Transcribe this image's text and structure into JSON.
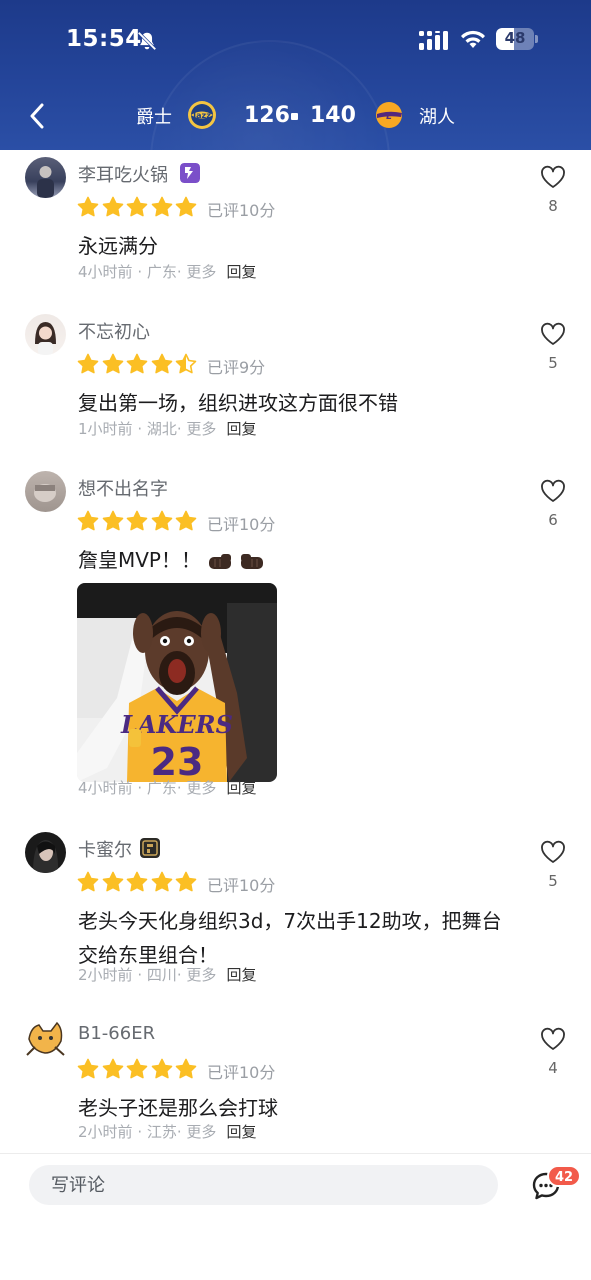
{
  "status_bar": {
    "time": "15:54",
    "battery": "48",
    "battery_fraction": 0.48
  },
  "header": {
    "home_team": "爵士",
    "home_score": "126",
    "away_score": "140",
    "away_team": "湖人",
    "accent": "#24459a"
  },
  "comments": [
    {
      "username": "李耳吃火锅",
      "rating_text": "已评10分",
      "stars": 5,
      "text": "永远满分",
      "time": "4小时前",
      "location": "广东",
      "more": "更多",
      "reply": "回复",
      "likes": "8"
    },
    {
      "username": "不忘初心",
      "rating_text": "已评9分",
      "stars": 4.5,
      "text": "复出第一场，组织进攻这方面很不错",
      "time": "1小时前",
      "location": "湖北",
      "more": "更多",
      "reply": "回复",
      "likes": "5"
    },
    {
      "username": "想不出名字",
      "rating_text": "已评10分",
      "stars": 5,
      "text": "詹皇MVP！！",
      "time": "4小时前",
      "location": "广东",
      "more": "更多",
      "reply": "回复",
      "likes": "6",
      "photo": {
        "jersey_team": "LAKERS",
        "jersey_number": "23"
      }
    },
    {
      "username": "卡蜜尔",
      "rating_text": "已评10分",
      "stars": 5,
      "text": "老头今天化身组织3d，7次出手12助攻，把舞台交给东里组合！",
      "time": "2小时前",
      "location": "四川",
      "more": "更多",
      "reply": "回复",
      "likes": "5"
    },
    {
      "username": "B1-66ER",
      "rating_text": "已评10分",
      "stars": 5,
      "text": "老头子还是那么会打球",
      "time": "2小时前",
      "location": "江苏",
      "more": "更多",
      "reply": "回复",
      "likes": "4"
    }
  ],
  "bottom_bar": {
    "input_placeholder": "写评论",
    "comment_count": "42"
  },
  "colors": {
    "star": "#fbbf24",
    "badge": "#f25a4a"
  }
}
